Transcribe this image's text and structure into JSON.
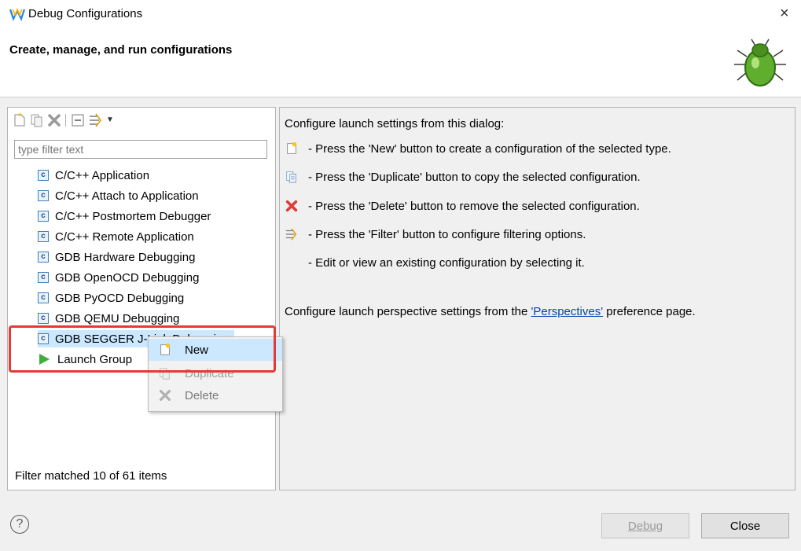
{
  "window": {
    "title": "Debug Configurations",
    "close_glyph": "×"
  },
  "header": {
    "title": "Create, manage, and run configurations"
  },
  "left": {
    "filter_placeholder": "type filter text",
    "items": [
      {
        "label": "C/C++ Application",
        "icon": "c-config-icon"
      },
      {
        "label": "C/C++ Attach to Application",
        "icon": "c-config-icon"
      },
      {
        "label": "C/C++ Postmortem Debugger",
        "icon": "c-config-icon"
      },
      {
        "label": "C/C++ Remote Application",
        "icon": "c-config-icon"
      },
      {
        "label": "GDB Hardware Debugging",
        "icon": "c-config-icon"
      },
      {
        "label": "GDB OpenOCD Debugging",
        "icon": "c-config-icon"
      },
      {
        "label": "GDB PyOCD Debugging",
        "icon": "c-config-icon"
      },
      {
        "label": "GDB QEMU Debugging",
        "icon": "c-config-icon"
      },
      {
        "label": "GDB SEGGER J-Link Debugging",
        "icon": "c-config-icon"
      },
      {
        "label": "Launch Group",
        "icon": "play-icon"
      }
    ],
    "status": "Filter matched 10 of 61 items"
  },
  "right": {
    "intro": "Configure launch settings from this dialog:",
    "lines": [
      {
        "icon": "new-icon",
        "text": "- Press the 'New' button to create a configuration of the selected type."
      },
      {
        "icon": "duplicate-icon",
        "text": "- Press the 'Duplicate' button to copy the selected configuration."
      },
      {
        "icon": "delete-icon",
        "text": "- Press the 'Delete' button to remove the selected configuration."
      },
      {
        "icon": "filter-icon",
        "text": "- Press the 'Filter' button to configure filtering options."
      },
      {
        "icon": "",
        "text": "- Edit or view an existing configuration by selecting it."
      }
    ],
    "perspectives_prefix": "Configure launch perspective settings from the ",
    "perspectives_link": "'Perspectives'",
    "perspectives_suffix": " preference page."
  },
  "context_menu": {
    "items": [
      {
        "label": "New",
        "enabled": true,
        "highlighted": true
      },
      {
        "label": "Duplicate",
        "enabled": false
      },
      {
        "label": "Delete",
        "enabled": false
      }
    ]
  },
  "buttons": {
    "debug": "Debug",
    "close": "Close",
    "help": "?"
  },
  "colors": {
    "highlight": "#e53935",
    "menu_selected": "#cce8ff",
    "link": "#0645ad"
  }
}
